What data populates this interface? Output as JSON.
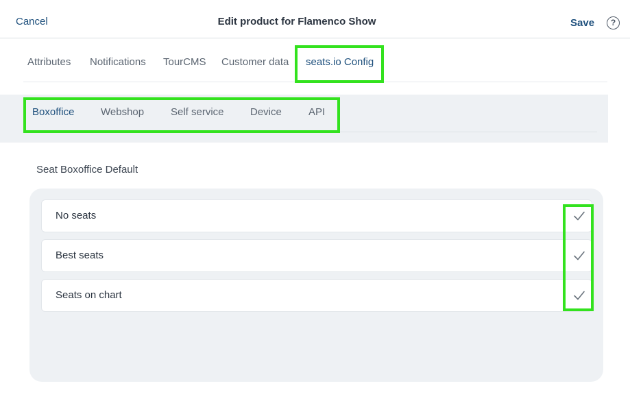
{
  "header": {
    "cancel_label": "Cancel",
    "title": "Edit product for Flamenco Show",
    "save_label": "Save",
    "help_glyph": "?"
  },
  "tabs": [
    {
      "label": "Attributes",
      "active": false
    },
    {
      "label": "Notifications",
      "active": false
    },
    {
      "label": "TourCMS",
      "active": false
    },
    {
      "label": "Customer data",
      "active": false
    },
    {
      "label": "seats.io Config",
      "active": true
    }
  ],
  "subtabs": [
    {
      "label": "Boxoffice",
      "active": true
    },
    {
      "label": "Webshop",
      "active": false
    },
    {
      "label": "Self service",
      "active": false
    },
    {
      "label": "Device",
      "active": false
    },
    {
      "label": "API",
      "active": false
    }
  ],
  "section": {
    "label": "Seat Boxoffice Default",
    "options": [
      {
        "label": "No seats",
        "icon": "checkmark-icon"
      },
      {
        "label": "Best seats",
        "icon": "checkmark-icon"
      },
      {
        "label": "Seats on chart",
        "icon": "checkmark-icon"
      }
    ]
  },
  "colors": {
    "accent": "#1d4f7c",
    "highlight": "#33e21e",
    "panel_bg": "#eef1f4",
    "text": "#2b3440"
  }
}
